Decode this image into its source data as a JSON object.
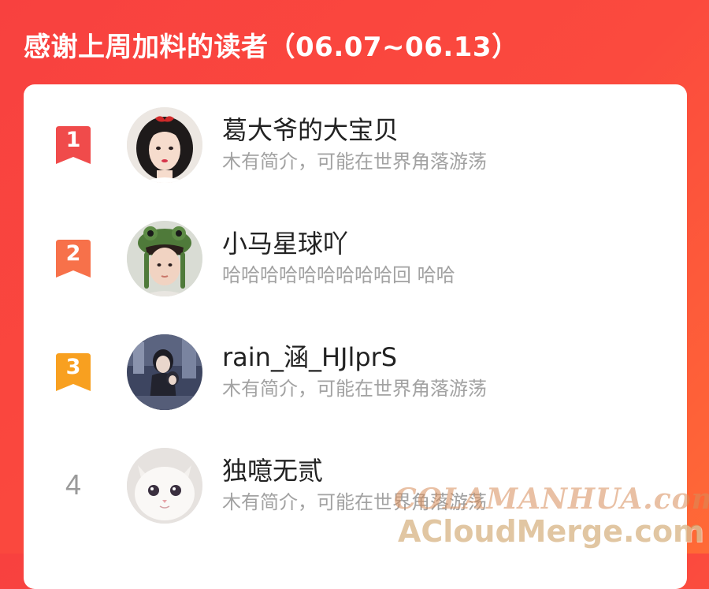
{
  "header": {
    "title": "感谢上周加料的读者（06.07~06.13）"
  },
  "readers": [
    {
      "rank": "1",
      "name": "葛大爷的大宝贝",
      "bio": "木有简介，可能在世界角落游荡",
      "badge_color": "#f04b4b"
    },
    {
      "rank": "2",
      "name": "小马星球吖",
      "bio": "哈哈哈哈哈哈哈哈哈回 哈哈",
      "badge_color": "#f7714a"
    },
    {
      "rank": "3",
      "name": "rain_涵_HJlprS",
      "bio": "木有简介，可能在世界角落游荡",
      "badge_color": "#f8a020"
    },
    {
      "rank": "4",
      "name": "独噫无贰",
      "bio": "木有简介，可能在世界角落游荡"
    }
  ],
  "watermark": {
    "line1": "COLAMANHUA.com",
    "line2": "ACloudMerge.com"
  },
  "colors": {
    "background": "#f8413f",
    "card": "#ffffff",
    "name_text": "#222222",
    "bio_text": "#a2a2a2"
  }
}
